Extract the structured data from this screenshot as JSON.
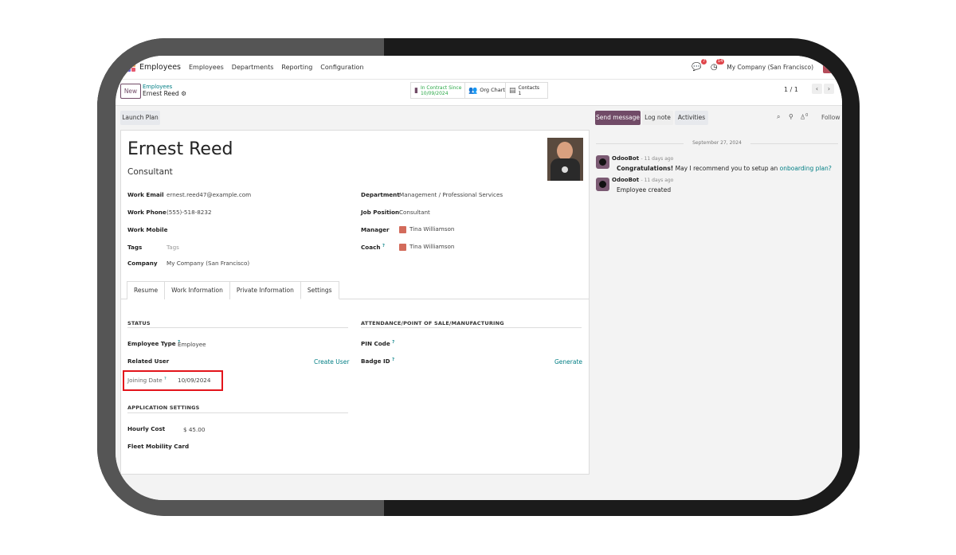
{
  "nav": {
    "app_name": "Employees",
    "menus": [
      "Employees",
      "Departments",
      "Reporting",
      "Configuration"
    ],
    "chat_badge": "7",
    "activity_badge": "14",
    "company": "My Company (San Francisco)"
  },
  "control": {
    "new_label": "New",
    "breadcrumb_parent": "Employees",
    "breadcrumb_current": "Ernest Reed",
    "smart_contract_line1": "In Contract Since",
    "smart_contract_line2": "10/09/2024",
    "smart_orgchart": "Org Chart",
    "smart_contacts_line1": "Contacts",
    "smart_contacts_line2": "1",
    "pager": "1 / 1"
  },
  "form": {
    "launch_plan": "Launch Plan",
    "name": "Ernest Reed",
    "job_title": "Consultant",
    "left_fields": [
      {
        "label": "Work Email",
        "value": "ernest.reed47@example.com"
      },
      {
        "label": "Work Phone",
        "value": "(555)-518-8232"
      },
      {
        "label": "Work Mobile",
        "value": ""
      },
      {
        "label": "Tags",
        "value": "Tags"
      },
      {
        "label": "Company",
        "value": "My Company (San Francisco)"
      }
    ],
    "right_fields": [
      {
        "label": "Department",
        "value": "Management / Professional Services"
      },
      {
        "label": "Job Position",
        "value": "Consultant"
      },
      {
        "label": "Manager",
        "value": "Tina Williamson"
      },
      {
        "label": "Coach",
        "value": "Tina Williamson"
      }
    ],
    "tabs": [
      "Resume",
      "Work Information",
      "Private Information",
      "Settings"
    ],
    "status_heading": "STATUS",
    "employee_type_label": "Employee Type",
    "employee_type_value": "Employee",
    "related_user_label": "Related User",
    "create_user": "Create User",
    "joining_date_label": "Joining Date",
    "joining_date_value": "10/09/2024",
    "app_settings_heading": "APPLICATION SETTINGS",
    "hourly_cost_label": "Hourly Cost",
    "hourly_cost_value": "$ 45.00",
    "fleet_label": "Fleet Mobility Card",
    "attendance_heading": "ATTENDANCE/POINT OF SALE/MANUFACTURING",
    "pin_label": "PIN Code",
    "badge_label": "Badge ID",
    "generate": "Generate",
    "help_mark": "?"
  },
  "chatter": {
    "send_message": "Send message",
    "log_note": "Log note",
    "activities": "Activities",
    "attachments_count": "0",
    "follow": "Follow",
    "date": "September 27, 2024",
    "messages": [
      {
        "author": "OdooBot",
        "time": "- 11 days ago",
        "bold": "Congratulations!",
        "text": " May I recommend you to setup an ",
        "link": "onboarding plan?"
      },
      {
        "author": "OdooBot",
        "time": "- 11 days ago",
        "text": "Employee created"
      }
    ]
  }
}
